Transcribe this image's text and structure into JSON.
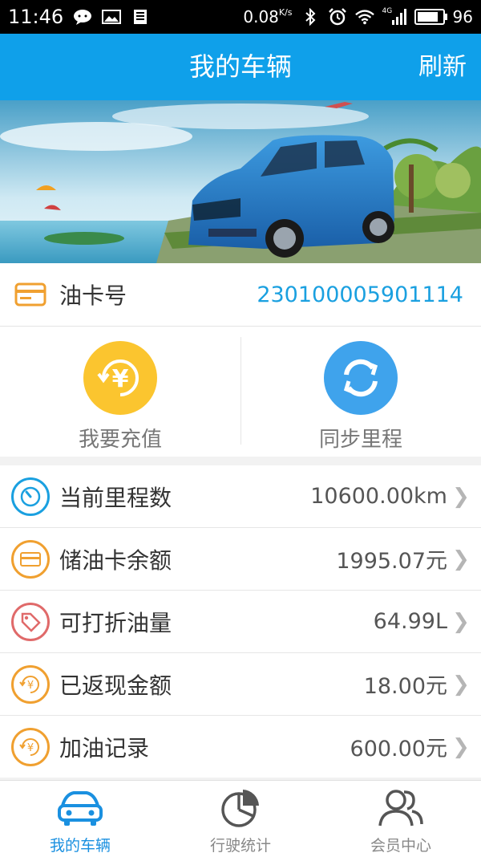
{
  "status_bar": {
    "time": "11:46",
    "net_speed": "0.08",
    "net_unit": "K/s",
    "network": "4G",
    "battery": "96",
    "battery_level": 0.96
  },
  "header": {
    "title": "我的车辆",
    "refresh_label": "刷新"
  },
  "oil_card": {
    "label": "油卡号",
    "number": "230100005901114"
  },
  "actions": [
    {
      "label": "我要充值",
      "icon": "yuan-recharge-icon",
      "color": "#fbc52f"
    },
    {
      "label": "同步里程",
      "icon": "sync-icon",
      "color": "#3fa3ec"
    }
  ],
  "list": [
    {
      "label": "当前里程数",
      "value": "10600.00km",
      "icon": "speedometer-icon",
      "color": "#1aa0e0"
    },
    {
      "label": "储油卡余额",
      "value": "1995.07元",
      "icon": "card-icon",
      "color": "#f0a030"
    },
    {
      "label": "可打折油量",
      "value": "64.99L",
      "icon": "tag-icon",
      "color": "#e06a6a"
    },
    {
      "label": "已返现金额",
      "value": "18.00元",
      "icon": "cashback-icon",
      "color": "#f0a030"
    },
    {
      "label": "加油记录",
      "value": "600.00元",
      "icon": "fuel-record-icon",
      "color": "#f0a030"
    }
  ],
  "tabs": [
    {
      "label": "我的车辆",
      "icon": "car-icon",
      "active": true
    },
    {
      "label": "行驶统计",
      "icon": "pie-chart-icon",
      "active": false
    },
    {
      "label": "会员中心",
      "icon": "members-icon",
      "active": false
    }
  ],
  "colors": {
    "header_blue": "#0fa0ea",
    "accent_blue": "#1a90e0"
  }
}
